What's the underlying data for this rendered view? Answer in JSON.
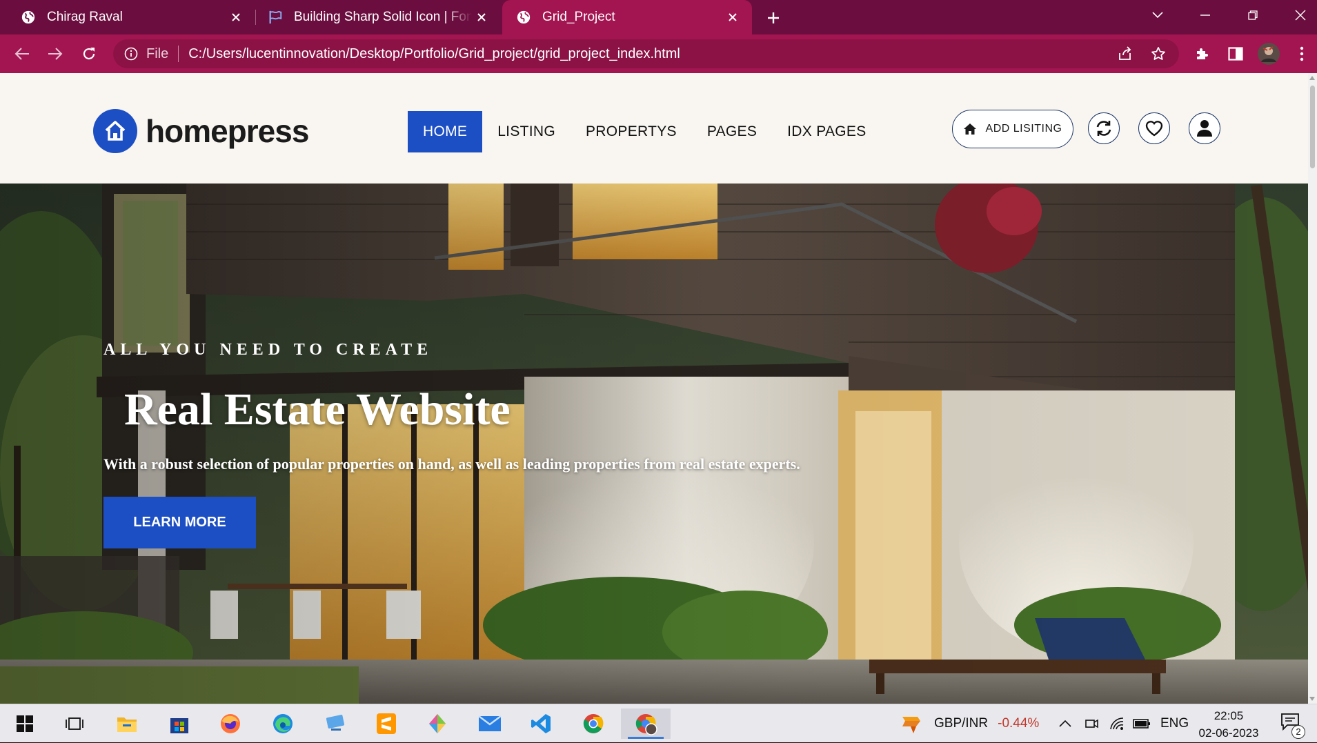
{
  "browser": {
    "tabs": [
      {
        "title": "Chirag Raval",
        "icon": "globe-icon"
      },
      {
        "title": "Building Sharp Solid Icon | Font Awesome",
        "icon": "flag-icon"
      },
      {
        "title": "Grid_Project",
        "icon": "globe-icon",
        "active": true
      }
    ],
    "address": {
      "scheme": "File",
      "url": "C:/Users/lucentinnovation/Desktop/Portfolio/Grid_project/grid_project_index.html"
    },
    "accent_color": "#a31551",
    "tabbar_color": "#6b0e3f"
  },
  "site": {
    "logo_text": "homepress",
    "nav": [
      {
        "label": "HOME",
        "active": true
      },
      {
        "label": "LISTING"
      },
      {
        "label": "PROPERTYS"
      },
      {
        "label": "PAGES"
      },
      {
        "label": "IDX PAGES"
      }
    ],
    "add_listing_label": "ADD LISITING",
    "brand_color": "#1d4fc4"
  },
  "hero": {
    "eyebrow": "ALL YOU NEED TO CREATE",
    "title": "Real Estate Website",
    "description": "With a robust selection of popular properties on hand, as well as leading properties from real estate experts.",
    "cta_label": "LEARN MORE"
  },
  "taskbar": {
    "apps": [
      "windows-start-icon",
      "task-view-icon",
      "file-explorer-icon",
      "microsoft-store-icon",
      "firefox-icon",
      "edge-icon",
      "remote-desktop-icon",
      "sublime-text-icon",
      "paint-3d-icon",
      "mail-icon",
      "vscode-icon",
      "chrome-icon",
      "chrome-profile-icon"
    ],
    "ticker_symbol": "GBP/INR",
    "ticker_change": "-0.44%",
    "language": "ENG",
    "time": "22:05",
    "date": "02-06-2023",
    "notification_count": "2"
  }
}
